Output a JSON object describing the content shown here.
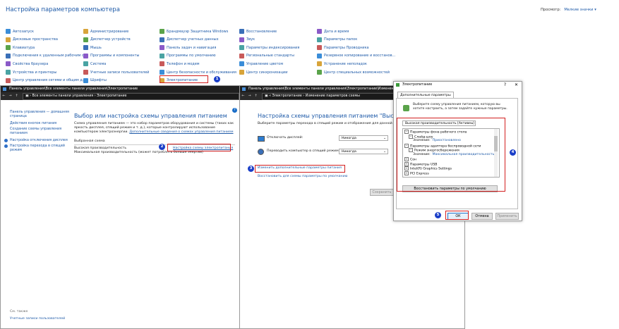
{
  "control_panel": {
    "title": "Настройка параметров компьютера",
    "view_label": "Просмотр:",
    "view_value": "Мелкие значки",
    "columns": [
      [
        "Автозапуск",
        "Дисковые пространства",
        "Клавиатура",
        "Подключения к удаленным рабочим с...",
        "Свойства браузера",
        "Устройства и принтеры",
        "Центр управления сетями и общим д..."
      ],
      [
        "Администрирование",
        "Диспетчер устройств",
        "Мышь",
        "Программы и компоненты",
        "Система",
        "Учетные записи пользователей",
        "Шрифты"
      ],
      [
        "Брандмауэр Защитника Windows",
        "Диспетчер учетных данных",
        "Панель задач и навигация",
        "Программы по умолчанию",
        "Телефон и модем",
        "Центр безопасности и обслуживания",
        "Электропитание"
      ],
      [
        "Восстановление",
        "Звук",
        "Параметры индексирования",
        "Региональные стандарты",
        "Управление цветом",
        "Центр синхронизации",
        ""
      ],
      [
        "Дата и время",
        "Параметры папок",
        "Параметры Проводника",
        "Резервное копирование и восстанов...",
        "Устранение неполадок",
        "Центр специальных возможностей",
        ""
      ]
    ]
  },
  "window1": {
    "title": "Панель управления\\Все элементы панели управления\\Электропитание",
    "crumbs": [
      "Все элементы панели управления",
      "Электропитание"
    ],
    "sidebar": [
      "Панель управления — домашняя страница",
      "Действия кнопок питания",
      "Создание схемы управления питанием",
      "Настройка отключения дисплея",
      "Настройка перехода в спящий режим"
    ],
    "heading": "Выбор или настройка схемы управления питанием",
    "description": "Схема управления питанием — это набор параметров оборудования и системы (таких как яркость дисплея, спящий режим и т. д.), которые контролируют использование компьютером электроэнергии.",
    "more_link": "Дополнительные сведения о схемах управления питанием",
    "selected_label": "Выбранная схема",
    "plans": [
      "Высокая производительность",
      "Максимальная производительность (может потреблять больше энергии)"
    ],
    "plan_settings_link": "Настройка схемы электропитания",
    "see_also": "См. также",
    "user_accounts": "Учетные записи пользователей"
  },
  "window2": {
    "title": "Панель управления\\Все элементы панели управления\\Электропитание\\Изменение параметров схемы",
    "crumbs": [
      "Электропитание",
      "Изменение параметров схемы"
    ],
    "heading": "Настройка схемы управления питанием \"Высокая произ...",
    "subtitle": "Выберите параметры перехода в спящий режим и отображения для данной схемы.",
    "row1_label": "Отключать дисплей:",
    "row1_value": "Никогда",
    "row2_label": "Переводить компьютер в спящий режим:",
    "row2_value": "Никогда",
    "advanced_link": "Изменить дополнительные параметры питания",
    "restore_link": "Восстановить для схемы параметры по умолчанию",
    "save_button": "Сохранить"
  },
  "dialog": {
    "title": "Электропитание",
    "help": "?",
    "close": "✕",
    "tab": "Дополнительные параметры",
    "intro": "Выберите схему управления питанием, которую вы хотите настроить, а затем задайте нужные параметры.",
    "scheme": "Высокая производительность [Активен]",
    "tree": [
      {
        "text": "Параметры фона рабочего стола",
        "level": 0,
        "exp": "−"
      },
      {
        "text": "Слайд-шоу",
        "level": 1,
        "exp": "−"
      },
      {
        "text": "Значение:",
        "value": "Приостановлено",
        "level": 2
      },
      {
        "text": "Параметры адаптера беспроводной сети",
        "level": 0,
        "exp": "−"
      },
      {
        "text": "Режим энергосбережения",
        "level": 1,
        "exp": "−"
      },
      {
        "text": "Значение:",
        "value": "Максимальная производительность",
        "level": 2
      },
      {
        "text": "Сон",
        "level": 0,
        "exp": "+"
      },
      {
        "text": "Параметры USB",
        "level": 0,
        "exp": "+"
      },
      {
        "text": "Intel(R) Graphics Settings",
        "level": 0,
        "exp": "+"
      },
      {
        "text": "PCI Express",
        "level": 0,
        "exp": "+"
      }
    ],
    "restore_button": "Восстановить параметры по умолчанию",
    "ok": "ОК",
    "cancel": "Отмена",
    "apply": "Применить"
  },
  "badges": [
    "1",
    "2",
    "3",
    "4",
    "5"
  ],
  "colors": {
    "link": "#1e5aa8",
    "highlight": "#d21f1f",
    "badge": "#1a3ec8"
  }
}
